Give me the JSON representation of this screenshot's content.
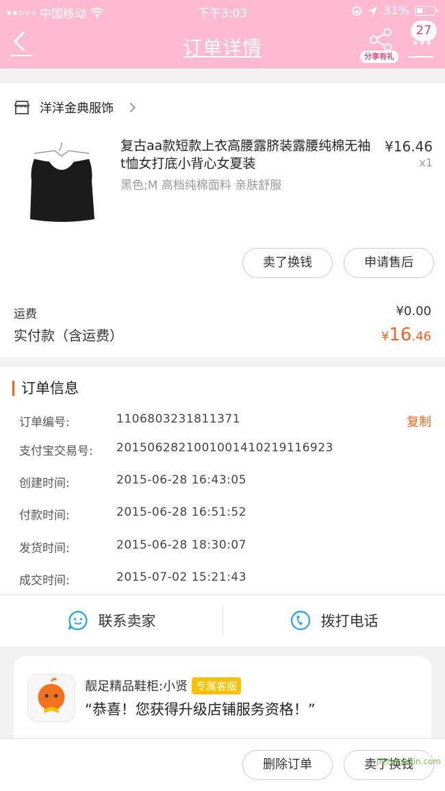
{
  "status_bar": {
    "carrier": "中国移动",
    "time": "下午3:03",
    "battery": "31%"
  },
  "nav": {
    "title": "订单详情",
    "share_label": "分享有礼",
    "badge_count": "27"
  },
  "shop": {
    "name": "洋洋金典服饰",
    "product": {
      "title": "复古aa款短款上衣高腰露脐装露腰纯棉无袖t恤女打底小背心女夏装",
      "spec": "黑色;M 高档纯棉面料 亲肤舒服",
      "price": "¥16.46",
      "qty": "x1"
    },
    "buttons": [
      "卖了换钱",
      "申请售后"
    ],
    "shipping_label": "运费",
    "shipping_value": "¥0.00",
    "paid_label": "实付款（含运费）",
    "paid_currency": "¥",
    "paid_int": "16",
    "paid_dec": ".46"
  },
  "order_info": {
    "heading": "订单信息",
    "copy_label": "复制",
    "rows": [
      {
        "label": "订单编号:",
        "value": "1106803231811371"
      },
      {
        "label": "支付宝交易号:",
        "value": "2015062821001001410219116923"
      },
      {
        "label": "创建时间:",
        "value": "2015-06-28 16:43:05"
      },
      {
        "label": "付款时间:",
        "value": "2015-06-28 16:51:52"
      },
      {
        "label": "发货时间:",
        "value": "2015-06-28 18:30:07"
      },
      {
        "label": "成交时间:",
        "value": "2015-07-02 15:21:43"
      }
    ],
    "actions": [
      "联系卖家",
      "拨打电话"
    ]
  },
  "service": {
    "name": "靓足精品鞋柜:小贤",
    "tag": "专属客服",
    "message": "“恭喜！您获得升级店铺服务资格！”"
  },
  "bottom_bar": {
    "buttons": [
      "删除订单",
      "卖了换钱"
    ]
  },
  "watermark": "JiChengXin.com",
  "colors": {
    "header": "#fdbad0",
    "accent": "#f5631f",
    "tag": "#fcc000"
  }
}
